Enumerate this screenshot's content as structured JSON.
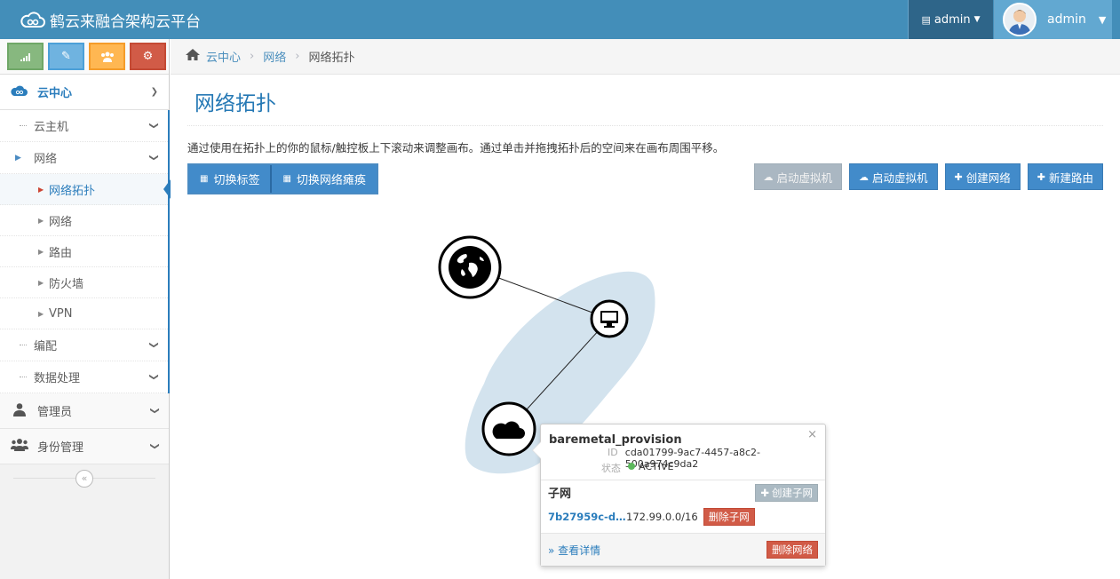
{
  "navbar": {
    "brand": "鹤云来融合架构云平台",
    "user_link": "admin",
    "profile_name": "admin"
  },
  "sidebar": {
    "shortcuts": [
      "signal-icon",
      "pencil-icon",
      "users-icon",
      "cogs-icon"
    ],
    "menu": {
      "cloud_center": "云中心",
      "instances": "云主机",
      "network": "网络",
      "network_sub": [
        "网络拓扑",
        "网络",
        "路由",
        "防火墙",
        "VPN"
      ],
      "orchestration": "编配",
      "data_processing": "数据处理",
      "admin": "管理员",
      "identity": "身份管理"
    }
  },
  "breadcrumb": {
    "items": [
      "云中心",
      "网络"
    ],
    "current": "网络拓扑"
  },
  "page": {
    "title": "网络拓扑",
    "description": "通过使用在拓扑上的你的鼠标/触控板上下滚动来调整画布。通过单击并拖拽拓扑后的空间来在画布周围平移。",
    "toggle_labels": "切换标签",
    "toggle_collapse": "切换网络瘫痪",
    "actions": {
      "launch_disabled": "启动虚拟机",
      "launch": "启动虚拟机",
      "create_network": "创建网络",
      "create_router": "新建路由"
    }
  },
  "popover": {
    "close": "×",
    "name": "baremetal_provision",
    "id_label": "ID",
    "id_value": "cda01799-9ac7-4457-a8c2-500a974c9da2",
    "status_label": "状态",
    "status_value": "ACTIVE",
    "subnet_header": "子网",
    "create_subnet": "创建子网",
    "subnet_id": "7b27959c-d…",
    "subnet_cidr": "172.99.0.0/16",
    "delete_subnet": "删除子网",
    "more": "» 查看详情",
    "delete_network": "删除网络"
  },
  "colors": {
    "navbar": "#438eb9",
    "accent": "#2679b5",
    "network_blob": "#d3e3ee",
    "danger": "#d15b47",
    "success": "#5cb85c"
  }
}
